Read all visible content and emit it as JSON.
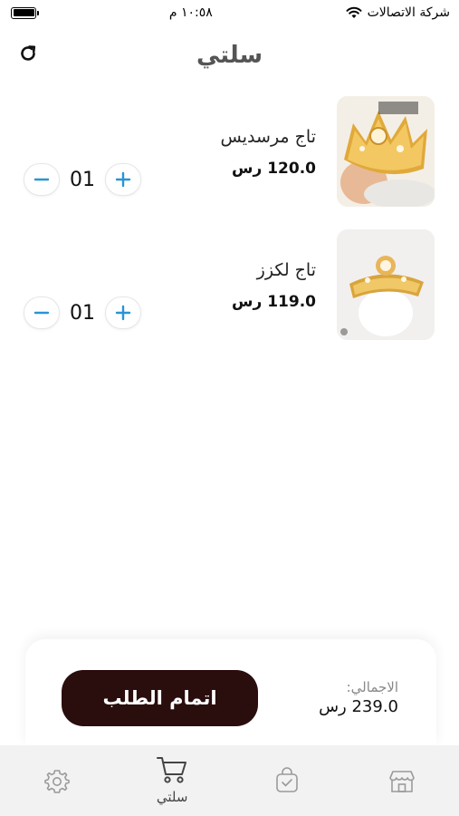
{
  "status_bar": {
    "carrier": "شركة الاتصالات",
    "time": "١٠:٥٨ م"
  },
  "header": {
    "title": "سلتي"
  },
  "cart": {
    "items": [
      {
        "name": "تاج مرسديس",
        "price": "120.0 رس",
        "quantity": "01"
      },
      {
        "name": "تاج لكزز",
        "price": "119.0 رس",
        "quantity": "01"
      }
    ]
  },
  "summary": {
    "total_label": "الاجمالي:",
    "total_value": "239.0 رس",
    "checkout_label": "اتمام الطلب"
  },
  "tabbar": {
    "tabs": [
      {
        "icon": "settings-icon",
        "label": ""
      },
      {
        "icon": "cart-icon",
        "label": "سلتي",
        "active": true
      },
      {
        "icon": "orders-icon",
        "label": ""
      },
      {
        "icon": "store-icon",
        "label": ""
      }
    ]
  },
  "colors": {
    "accent": "#2a94d6",
    "checkout_bg": "#2a0d0d",
    "tabbar_bg": "#f2f2f2"
  }
}
